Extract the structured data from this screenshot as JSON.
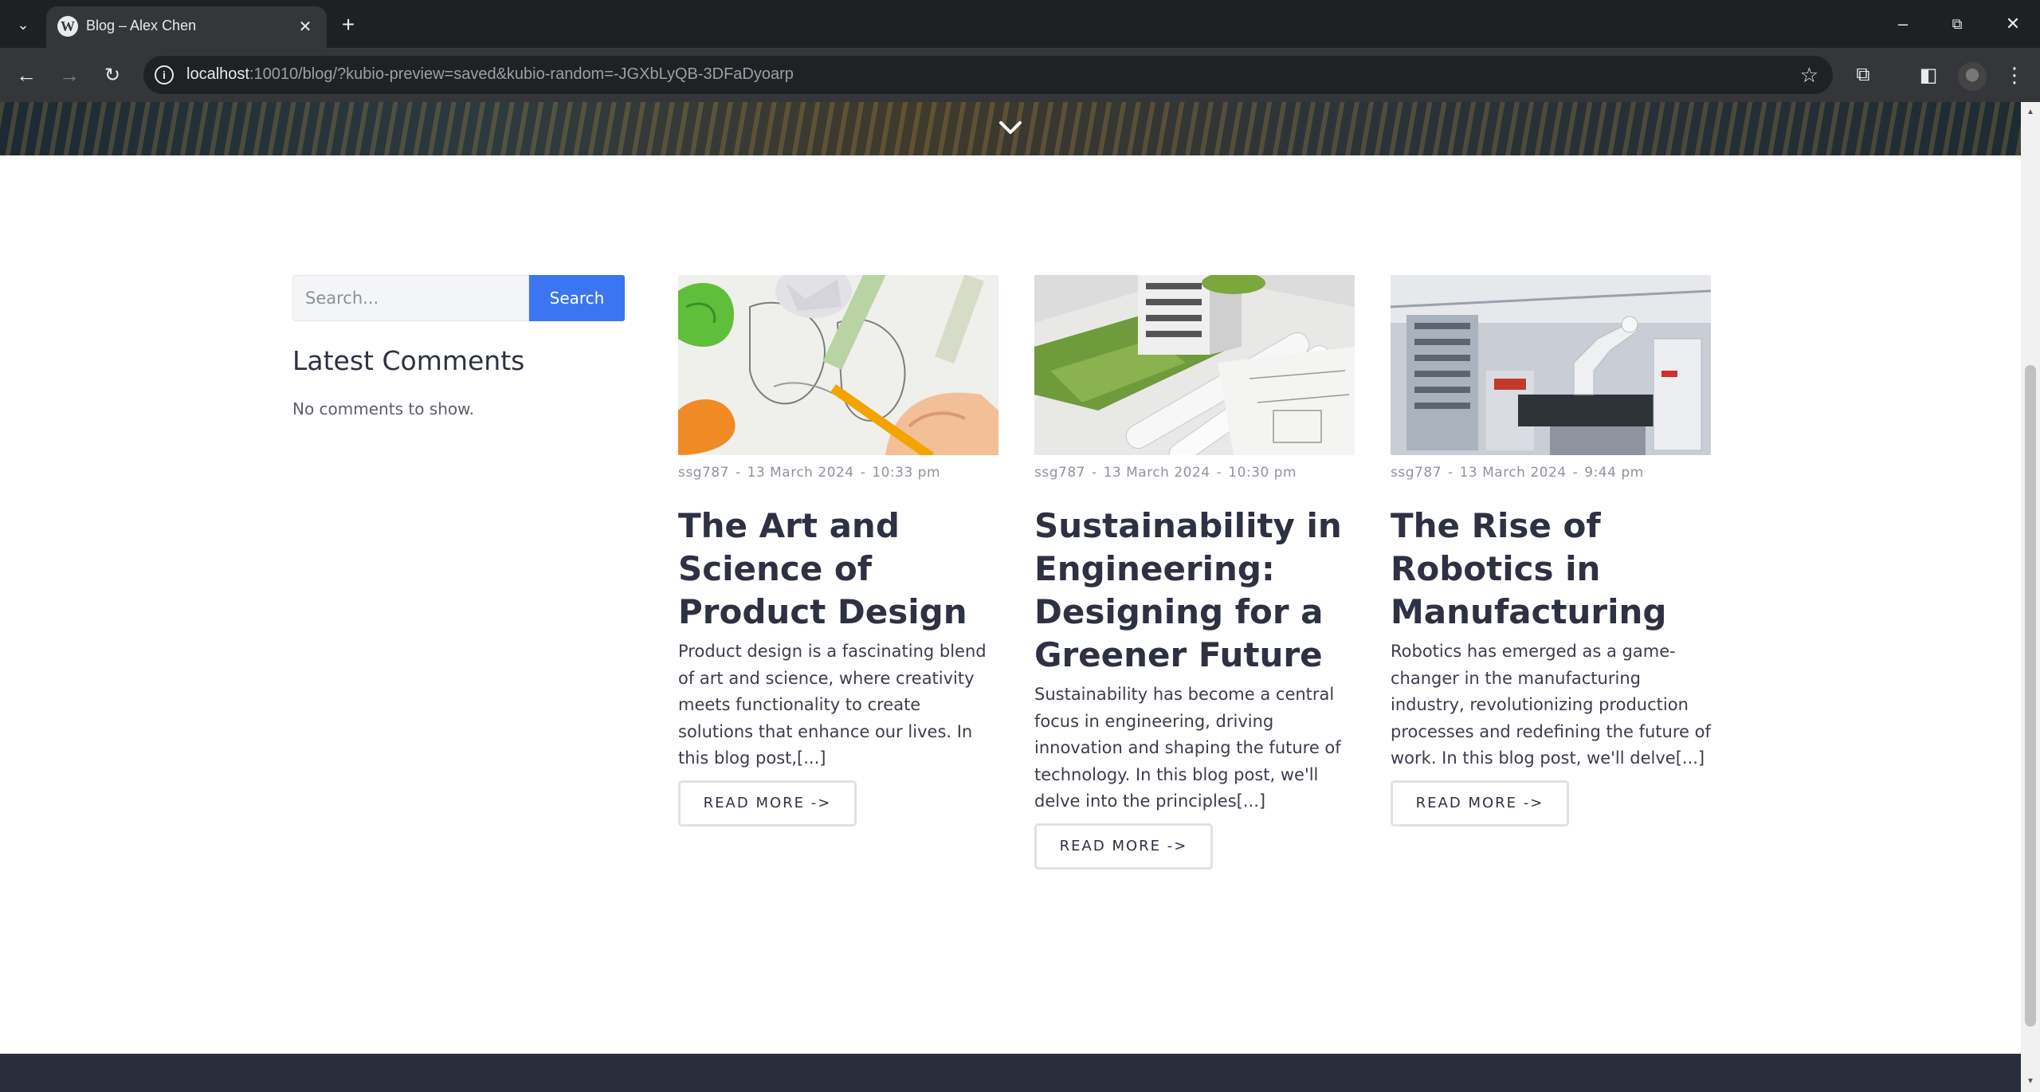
{
  "browser": {
    "tab_title": "Blog – Alex Chen",
    "url_host": "localhost",
    "url_rest": ":10010/blog/?kubio-preview=saved&kubio-random=-JGXbLyQB-3DFaDyoarp"
  },
  "sidebar": {
    "search_placeholder": "Search...",
    "search_button": "Search",
    "latest_comments_title": "Latest Comments",
    "no_comments": "No comments to show."
  },
  "posts": [
    {
      "author": "ssg787",
      "date": "13 March 2024",
      "time": "10:33 pm",
      "title": "The Art and Science of Product Design",
      "excerpt": "Product design is a fascinating blend of art and science, where creativity meets functionality to create solutions that enhance our lives. In this blog post,[...]",
      "read_more": "READ MORE ->"
    },
    {
      "author": "ssg787",
      "date": "13 March 2024",
      "time": "10:30 pm",
      "title": "Sustainability in Engineering: Designing for a Greener Future",
      "excerpt": "Sustainability has become a central focus in engineering, driving innovation and shaping the future of technology. In this blog post, we'll delve into the principles[...]",
      "read_more": "READ MORE ->"
    },
    {
      "author": "ssg787",
      "date": "13 March 2024",
      "time": "9:44 pm",
      "title": "The Rise of Robotics in Manufacturing",
      "excerpt": "Robotics has emerged as a game-changer in the manufacturing industry, revolutionizing production processes and redefining the future of work. In this blog post, we'll delve[...]",
      "read_more": "READ MORE ->"
    }
  ],
  "colors": {
    "accent": "#3b75f0",
    "heading": "#2d3142",
    "footer": "#2a2d3c"
  }
}
